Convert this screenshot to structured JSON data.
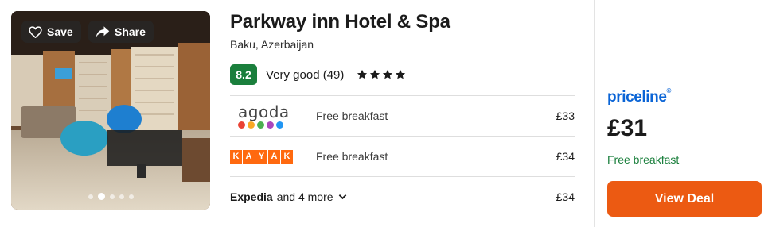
{
  "hotel": {
    "name": "Parkway inn Hotel & Spa",
    "location": "Baku, Azerbaijan",
    "score": "8.2",
    "rating_label": "Very good (49)",
    "star_class": 4
  },
  "photo": {
    "save_label": "Save",
    "share_label": "Share",
    "icons": {
      "save": "heart-icon",
      "share": "share-arrow-icon"
    },
    "carousel": {
      "dot_count": 5,
      "active_index": 1
    }
  },
  "offers": [
    {
      "provider": "agoda",
      "logo_text": "agoda",
      "description": "Free breakfast",
      "price": "£33"
    },
    {
      "provider": "kayak",
      "logo_text": "KAYAK",
      "description": "Free breakfast",
      "price": "£34"
    }
  ],
  "more_offers": {
    "brand": "Expedia",
    "more_text": "and 4 more",
    "price": "£34",
    "icon": "chevron-down-icon"
  },
  "deal": {
    "provider": "priceline",
    "price": "£31",
    "note": "Free breakfast",
    "button_label": "View Deal"
  },
  "colors": {
    "score_green": "#1a7f3c",
    "deal_orange": "#ec5a12",
    "priceline_blue": "#0a64d6",
    "kayak_orange": "#ff690f",
    "agoda_dots": [
      "#ea4335",
      "#f9a825",
      "#4caf50",
      "#ab47bc",
      "#2196f3"
    ]
  }
}
